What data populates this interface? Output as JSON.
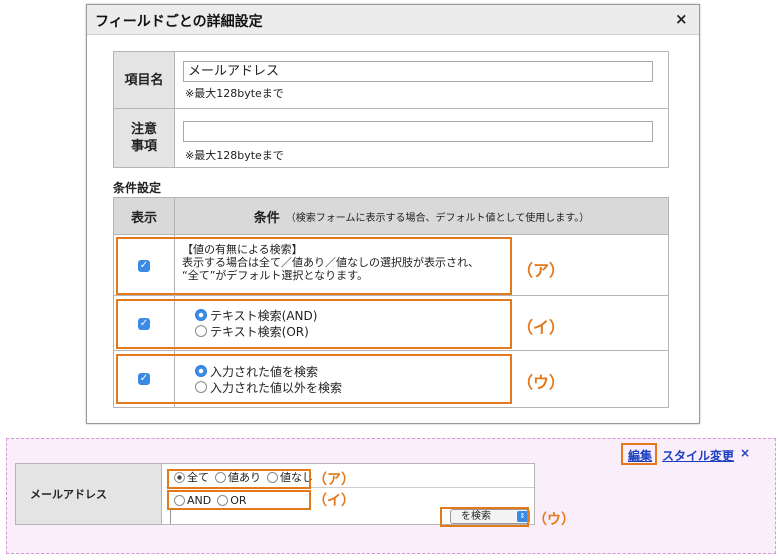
{
  "dialog": {
    "title": "フィールドごとの詳細設定",
    "close": "×",
    "field_name": {
      "label": "項目名",
      "value": "メールアドレス",
      "note": "※最大128byteまで"
    },
    "caution": {
      "label_line1": "注意",
      "label_line2": "事項",
      "value": "",
      "note": "※最大128byteまで"
    },
    "conditions": {
      "section_title": "条件設定",
      "col_display": "表示",
      "col_condition": "条件",
      "col_condition_note": "（検索フォームに表示する場合、デフォルト値として使用します。）",
      "rows": [
        {
          "checked": true,
          "title": "【値の有無による検索】",
          "desc1": "表示する場合は全て／値あり／値なしの選択肢が表示され、",
          "desc2": "“全て”がデフォルト選択となります。",
          "marker": "（ア）"
        },
        {
          "checked": true,
          "options": [
            "テキスト検索(AND)",
            "テキスト検索(OR)"
          ],
          "selected": 0,
          "marker": "（イ）"
        },
        {
          "checked": true,
          "options": [
            "入力された値を検索",
            "入力された値以外を検索"
          ],
          "selected": 0,
          "marker": "（ウ）"
        }
      ]
    }
  },
  "preview": {
    "links": {
      "edit": "編集",
      "style": "スタイル変更",
      "close": "×"
    },
    "field_label": "メールアドレス",
    "row_a": {
      "options": [
        "全て",
        "値あり",
        "値なし"
      ],
      "selected": 0,
      "marker": "（ア）"
    },
    "row_b": {
      "options": [
        "AND",
        "OR"
      ],
      "marker": "（イ）"
    },
    "row_c": {
      "select_value": "を検索",
      "marker": "（ウ）"
    }
  },
  "colors": {
    "accent_orange": "#e2791d",
    "checkbox_blue": "#3b8be6",
    "link_blue": "#1a3fc0"
  }
}
